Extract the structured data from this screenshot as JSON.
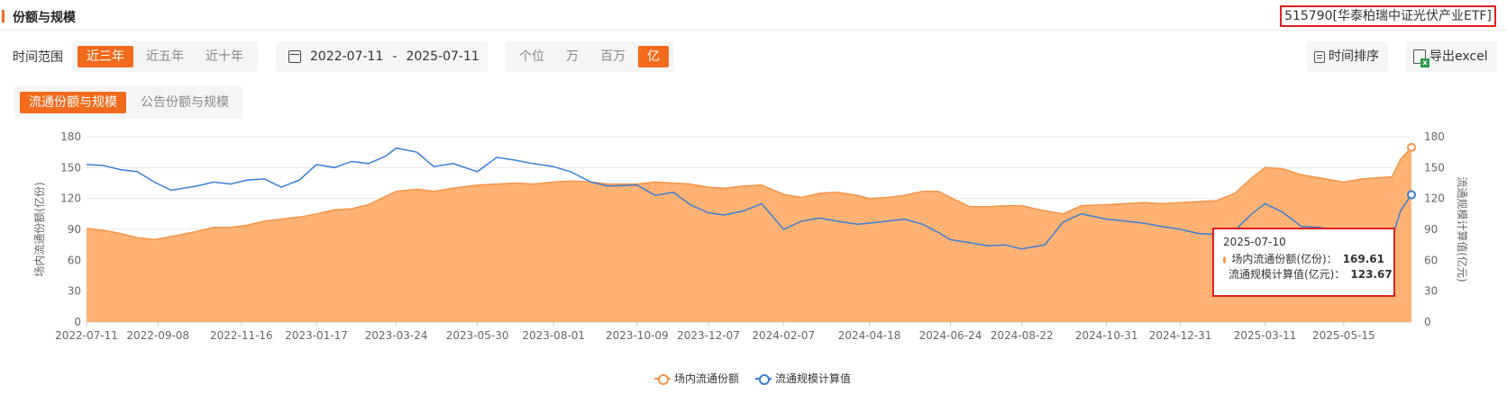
{
  "header": {
    "title": "份额与规模",
    "fund_name": "515790[华泰柏瑞中证光伏产业ETF]"
  },
  "controls": {
    "time_range_label": "时间范围",
    "time_ranges": [
      {
        "label": "近三年",
        "active": true
      },
      {
        "label": "近五年",
        "active": false
      },
      {
        "label": "近十年",
        "active": false
      }
    ],
    "date_from": "2022-07-11",
    "date_sep": "-",
    "date_to": "2025-07-11",
    "units": [
      {
        "label": "个位",
        "active": false
      },
      {
        "label": "万",
        "active": false
      },
      {
        "label": "百万",
        "active": false
      },
      {
        "label": "亿",
        "active": true
      }
    ],
    "sort_button": "时间排序",
    "export_button": "导出excel"
  },
  "tabs": [
    {
      "label": "流通份额与规模",
      "active": true
    },
    {
      "label": "公告份额与规模",
      "active": false
    }
  ],
  "tooltip": {
    "date": "2025-07-10",
    "rows": [
      {
        "name": "场内流通份额(亿份)：",
        "value": "169.61"
      },
      {
        "name": "流通规模计算值(亿元)：",
        "value": "123.67"
      }
    ]
  },
  "colors": {
    "accent": "#f26b1d",
    "share_line": "#f5944a",
    "share_fill": "#ffae6b",
    "scale_line": "#3a7fd5",
    "highlight_border": "#e02020"
  },
  "chart_data": {
    "type": "area",
    "x_start": "2022-07-11",
    "x_end": "2025-07-10",
    "x_ticks": [
      "2022-07-11",
      "2022-09-08",
      "2022-11-16",
      "2023-01-17",
      "2023-03-24",
      "2023-05-30",
      "2023-08-01",
      "2023-10-09",
      "2023-12-07",
      "2024-02-07",
      "2024-04-18",
      "2024-06-24",
      "2024-08-22",
      "2024-10-31",
      "2024-12-31",
      "2025-03-11",
      "2025-05-15"
    ],
    "y_left_label": "场内流通份额(亿份)",
    "y_right_label": "流通规模计算值(亿元)",
    "y_left_range": [
      0,
      180
    ],
    "y_right_range": [
      0,
      180
    ],
    "y_ticks": [
      0,
      30,
      60,
      90,
      120,
      150,
      180
    ],
    "series": [
      {
        "name": "场内流通份额",
        "axis": "left",
        "style": "area",
        "points": [
          [
            "2022-07-11",
            91
          ],
          [
            "2022-07-25",
            89
          ],
          [
            "2022-08-08",
            86
          ],
          [
            "2022-08-22",
            82
          ],
          [
            "2022-09-05",
            80
          ],
          [
            "2022-09-19",
            83
          ],
          [
            "2022-10-10",
            88
          ],
          [
            "2022-10-24",
            92
          ],
          [
            "2022-11-07",
            92
          ],
          [
            "2022-11-21",
            94
          ],
          [
            "2022-12-05",
            98
          ],
          [
            "2022-12-19",
            100
          ],
          [
            "2023-01-03",
            102
          ],
          [
            "2023-01-17",
            105
          ],
          [
            "2023-02-01",
            109
          ],
          [
            "2023-02-15",
            110
          ],
          [
            "2023-03-01",
            114
          ],
          [
            "2023-03-15",
            122
          ],
          [
            "2023-03-24",
            127
          ],
          [
            "2023-04-10",
            129
          ],
          [
            "2023-04-24",
            127
          ],
          [
            "2023-05-10",
            130
          ],
          [
            "2023-05-30",
            133
          ],
          [
            "2023-06-15",
            134
          ],
          [
            "2023-07-01",
            135
          ],
          [
            "2023-07-15",
            134
          ],
          [
            "2023-08-01",
            136
          ],
          [
            "2023-08-15",
            137
          ],
          [
            "2023-09-01",
            136
          ],
          [
            "2023-09-15",
            134
          ],
          [
            "2023-10-09",
            134
          ],
          [
            "2023-10-24",
            136
          ],
          [
            "2023-11-08",
            135
          ],
          [
            "2023-11-22",
            134
          ],
          [
            "2023-12-07",
            131
          ],
          [
            "2023-12-20",
            130
          ],
          [
            "2024-01-05",
            132
          ],
          [
            "2024-01-20",
            133
          ],
          [
            "2024-02-07",
            124
          ],
          [
            "2024-02-22",
            121
          ],
          [
            "2024-03-08",
            125
          ],
          [
            "2024-03-22",
            126
          ],
          [
            "2024-04-08",
            123
          ],
          [
            "2024-04-18",
            120
          ],
          [
            "2024-05-03",
            121
          ],
          [
            "2024-05-17",
            123
          ],
          [
            "2024-06-01",
            127
          ],
          [
            "2024-06-14",
            127
          ],
          [
            "2024-06-24",
            121
          ],
          [
            "2024-07-10",
            112
          ],
          [
            "2024-07-25",
            112
          ],
          [
            "2024-08-08",
            113
          ],
          [
            "2024-08-22",
            113
          ],
          [
            "2024-09-10",
            108
          ],
          [
            "2024-09-25",
            105
          ],
          [
            "2024-10-10",
            113
          ],
          [
            "2024-10-31",
            114
          ],
          [
            "2024-11-15",
            115
          ],
          [
            "2024-12-01",
            116
          ],
          [
            "2024-12-15",
            115
          ],
          [
            "2024-12-31",
            116
          ],
          [
            "2025-01-15",
            117
          ],
          [
            "2025-01-30",
            118
          ],
          [
            "2025-02-14",
            125
          ],
          [
            "2025-02-28",
            140
          ],
          [
            "2025-03-11",
            150
          ],
          [
            "2025-03-25",
            149
          ],
          [
            "2025-04-10",
            143
          ],
          [
            "2025-04-25",
            140
          ],
          [
            "2025-05-15",
            136
          ],
          [
            "2025-05-30",
            139
          ],
          [
            "2025-06-10",
            140
          ],
          [
            "2025-06-24",
            141
          ],
          [
            "2025-07-01",
            158
          ],
          [
            "2025-07-10",
            169.61
          ]
        ]
      },
      {
        "name": "流通规模计算值",
        "axis": "right",
        "style": "line",
        "points": [
          [
            "2022-07-11",
            153
          ],
          [
            "2022-07-25",
            152
          ],
          [
            "2022-08-08",
            148
          ],
          [
            "2022-08-22",
            146
          ],
          [
            "2022-09-05",
            136
          ],
          [
            "2022-09-19",
            128
          ],
          [
            "2022-10-10",
            132
          ],
          [
            "2022-10-24",
            136
          ],
          [
            "2022-11-07",
            134
          ],
          [
            "2022-11-21",
            138
          ],
          [
            "2022-12-05",
            139
          ],
          [
            "2022-12-19",
            131
          ],
          [
            "2023-01-03",
            138
          ],
          [
            "2023-01-17",
            153
          ],
          [
            "2023-02-01",
            150
          ],
          [
            "2023-02-15",
            156
          ],
          [
            "2023-03-01",
            154
          ],
          [
            "2023-03-15",
            161
          ],
          [
            "2023-03-24",
            169
          ],
          [
            "2023-04-10",
            165
          ],
          [
            "2023-04-24",
            151
          ],
          [
            "2023-05-10",
            154
          ],
          [
            "2023-05-30",
            146
          ],
          [
            "2023-06-15",
            160
          ],
          [
            "2023-07-01",
            157
          ],
          [
            "2023-07-15",
            154
          ],
          [
            "2023-08-01",
            151
          ],
          [
            "2023-08-15",
            146
          ],
          [
            "2023-09-01",
            136
          ],
          [
            "2023-09-15",
            132
          ],
          [
            "2023-10-09",
            133
          ],
          [
            "2023-10-24",
            123
          ],
          [
            "2023-11-08",
            126
          ],
          [
            "2023-11-22",
            114
          ],
          [
            "2023-12-07",
            106
          ],
          [
            "2023-12-20",
            104
          ],
          [
            "2024-01-05",
            108
          ],
          [
            "2024-01-20",
            115
          ],
          [
            "2024-02-07",
            90
          ],
          [
            "2024-02-22",
            98
          ],
          [
            "2024-03-08",
            101
          ],
          [
            "2024-03-22",
            98
          ],
          [
            "2024-04-08",
            95
          ],
          [
            "2024-04-18",
            96
          ],
          [
            "2024-05-03",
            98
          ],
          [
            "2024-05-17",
            100
          ],
          [
            "2024-06-01",
            95
          ],
          [
            "2024-06-14",
            87
          ],
          [
            "2024-06-24",
            80
          ],
          [
            "2024-07-10",
            77
          ],
          [
            "2024-07-25",
            74
          ],
          [
            "2024-08-08",
            75
          ],
          [
            "2024-08-22",
            71
          ],
          [
            "2024-09-10",
            75
          ],
          [
            "2024-09-25",
            97
          ],
          [
            "2024-10-10",
            105
          ],
          [
            "2024-10-31",
            100
          ],
          [
            "2024-11-15",
            98
          ],
          [
            "2024-12-01",
            96
          ],
          [
            "2024-12-15",
            93
          ],
          [
            "2024-12-31",
            90
          ],
          [
            "2025-01-15",
            86
          ],
          [
            "2025-01-30",
            85
          ],
          [
            "2025-02-14",
            89
          ],
          [
            "2025-02-28",
            105
          ],
          [
            "2025-03-11",
            115
          ],
          [
            "2025-03-25",
            107
          ],
          [
            "2025-04-10",
            93
          ],
          [
            "2025-04-25",
            92
          ],
          [
            "2025-05-15",
            88
          ],
          [
            "2025-05-30",
            86
          ],
          [
            "2025-06-10",
            84
          ],
          [
            "2025-06-24",
            82
          ],
          [
            "2025-07-01",
            108
          ],
          [
            "2025-07-10",
            123.67
          ]
        ]
      }
    ],
    "grid": true,
    "legend_position": "bottom-center"
  }
}
